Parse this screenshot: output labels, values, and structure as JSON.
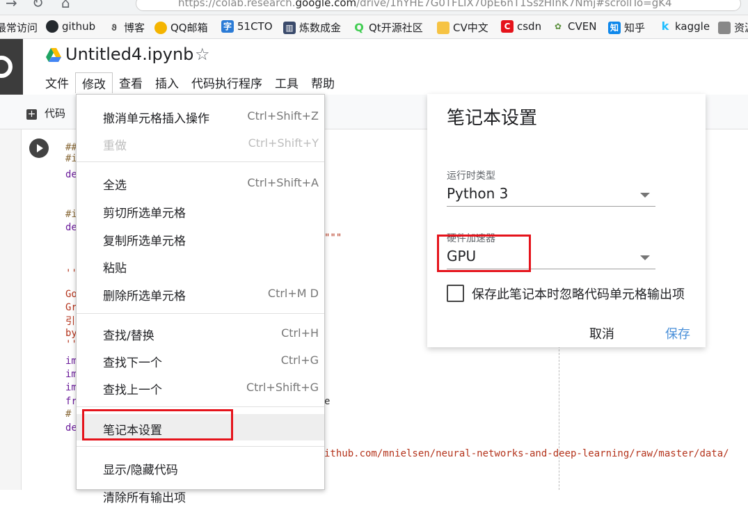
{
  "browser": {
    "url_prefix": "https://colab.research.",
    "url_domain": "google.com",
    "url_rest": "/drive/1hYHE7G0TFLIX70pE6nT1SszHInK7Nmj#scrollTo=gK4",
    "bookmarks": [
      {
        "label": "最常访问",
        "icon": "none"
      },
      {
        "label": "github",
        "icon": "github-icon",
        "color": "#24292e"
      },
      {
        "label": "博客",
        "icon": "blog-icon",
        "color": "#555555"
      },
      {
        "label": "QQ邮箱",
        "icon": "qq-mail-icon",
        "color": "#f4b400"
      },
      {
        "label": "51CTO",
        "icon": "51cto-icon",
        "color": "#2b7bd6"
      },
      {
        "label": "炼数成金",
        "icon": "chart-icon",
        "color": "#3a4a6b"
      },
      {
        "label": "Qt开源社区",
        "icon": "qt-icon",
        "color": "#41cd52"
      },
      {
        "label": "CV中文",
        "icon": "folder-icon",
        "color": "#f6c343"
      },
      {
        "label": "csdn",
        "icon": "csdn-icon",
        "color": "#e5131b"
      },
      {
        "label": "CVEN",
        "icon": "cven-icon",
        "color": "#5a8f3c"
      },
      {
        "label": "知乎",
        "icon": "zhihu-icon",
        "color": "#0f88eb"
      },
      {
        "label": "kaggle",
        "icon": "kaggle-icon",
        "color": "#20beff"
      },
      {
        "label": "资源",
        "icon": "folder-icon",
        "color": "#888888"
      }
    ]
  },
  "header": {
    "title": "Untitled4.ipynb",
    "menu": [
      "文件",
      "修改",
      "查看",
      "插入",
      "代码执行程序",
      "工具",
      "帮助"
    ],
    "active_menu": "修改",
    "add_code": "代码"
  },
  "code": {
    "lines": [
      {
        "text": "##",
        "kind": "cm"
      },
      {
        "text": "#i",
        "kind": "cm"
      },
      {
        "text": "de",
        "kind": "kw"
      },
      {
        "text": "#i",
        "kind": "cm"
      },
      {
        "text": "de",
        "kind": "kw"
      },
      {
        "text": "\"\"\"",
        "kind": "str"
      },
      {
        "text": "''",
        "kind": "str"
      },
      {
        "text": "Go",
        "kind": "str"
      },
      {
        "text": "Gr",
        "kind": "str"
      },
      {
        "text": "引",
        "kind": "str"
      },
      {
        "text": "by",
        "kind": "str"
      },
      {
        "text": "''",
        "kind": "str"
      },
      {
        "text": "im",
        "kind": "kw"
      },
      {
        "text": "im",
        "kind": "kw"
      },
      {
        "text": "im",
        "kind": "kw"
      },
      {
        "text": "fr",
        "kind": "kw"
      },
      {
        "text": "e",
        "kind": ""
      },
      {
        "text": "#",
        "kind": "cm"
      },
      {
        "text": "de",
        "kind": "kw"
      },
      {
        "text": "ithub.com/mnielsen/neural-networks-and-deep-learning/raw/master/data/",
        "kind": "str"
      }
    ]
  },
  "edit_menu": {
    "items": [
      {
        "label": "撤消单元格插入操作",
        "shortcut": "Ctrl+Shift+Z",
        "disabled": false
      },
      {
        "label": "重做",
        "shortcut": "Ctrl+Shift+Y",
        "disabled": true
      },
      {
        "label": "全选",
        "shortcut": "Ctrl+Shift+A",
        "disabled": false
      },
      {
        "label": "剪切所选单元格",
        "shortcut": "",
        "disabled": false
      },
      {
        "label": "复制所选单元格",
        "shortcut": "",
        "disabled": false
      },
      {
        "label": "粘贴",
        "shortcut": "",
        "disabled": false
      },
      {
        "label": "删除所选单元格",
        "shortcut": "Ctrl+M D",
        "disabled": false
      },
      {
        "label": "查找/替换",
        "shortcut": "Ctrl+H",
        "disabled": false
      },
      {
        "label": "查找下一个",
        "shortcut": "Ctrl+G",
        "disabled": false
      },
      {
        "label": "查找上一个",
        "shortcut": "Ctrl+Shift+G",
        "disabled": false
      },
      {
        "label": "笔记本设置",
        "shortcut": "",
        "disabled": false,
        "highlighted": true
      },
      {
        "label": "显示/隐藏代码",
        "shortcut": "",
        "disabled": false
      },
      {
        "label": "清除所有输出项",
        "shortcut": "",
        "disabled": false
      }
    ]
  },
  "settings_dialog": {
    "title": "笔记本设置",
    "runtime_label": "运行时类型",
    "runtime_value": "Python 3",
    "accelerator_label": "硬件加速器",
    "accelerator_value": "GPU",
    "omit_output_label": "保存此笔记本时忽略代码单元格输出项",
    "omit_output_checked": false,
    "cancel": "取消",
    "save": "保存"
  },
  "colors": {
    "annotation_red": "#e5131b",
    "save_blue": "#4a90d9"
  }
}
